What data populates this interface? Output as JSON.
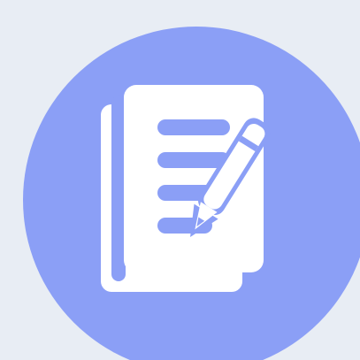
{
  "app_icon": {
    "icon": "notes-edit-icon",
    "colors": {
      "background": "#e8edf4",
      "circle": "#8b9ff6",
      "paper": "#ffffff",
      "lines": "#8b9ff6",
      "pencil": "#ffffff"
    }
  }
}
